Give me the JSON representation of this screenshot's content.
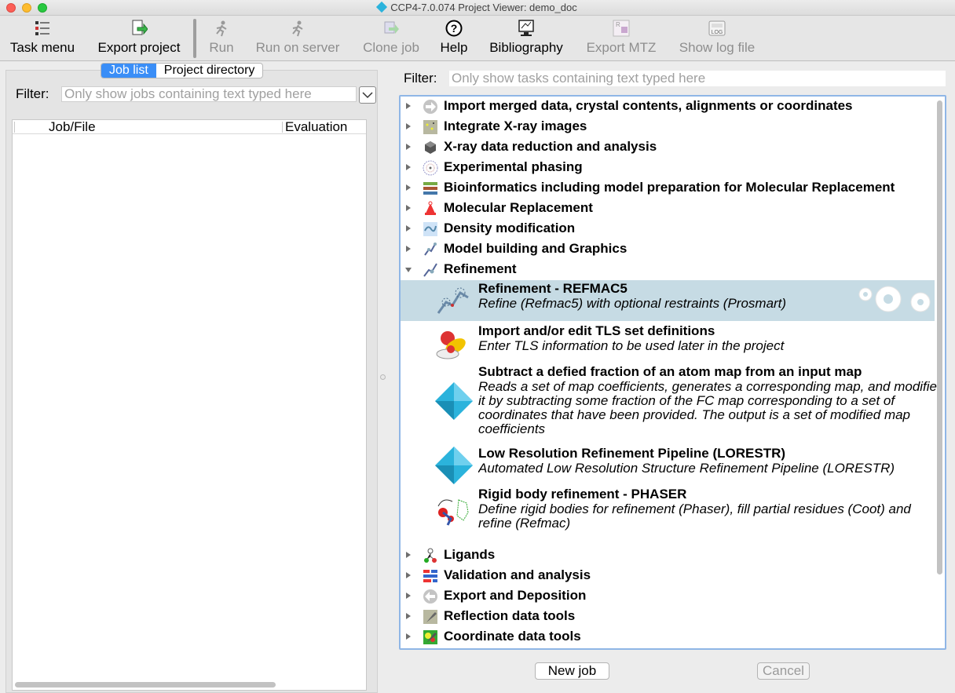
{
  "window": {
    "title": "CCP4-7.0.074 Project Viewer: demo_doc"
  },
  "toolbar": {
    "items": [
      {
        "label": "Task menu",
        "icon": "task-menu-icon",
        "enabled": true
      },
      {
        "label": "Export project",
        "icon": "export-project-icon",
        "enabled": true
      },
      {
        "label": "Run",
        "icon": "run-icon",
        "enabled": false
      },
      {
        "label": "Run on server",
        "icon": "run-server-icon",
        "enabled": false
      },
      {
        "label": "Clone job",
        "icon": "clone-job-icon",
        "enabled": false
      },
      {
        "label": "Help",
        "icon": "help-icon",
        "enabled": true
      },
      {
        "label": "Bibliography",
        "icon": "bibliography-icon",
        "enabled": true
      },
      {
        "label": "Export MTZ",
        "icon": "export-mtz-icon",
        "enabled": false
      },
      {
        "label": "Show log file",
        "icon": "log-file-icon",
        "enabled": false
      }
    ]
  },
  "left": {
    "tabs": [
      {
        "label": "Job list",
        "active": true
      },
      {
        "label": "Project directory",
        "active": false
      }
    ],
    "filter_label": "Filter:",
    "filter_placeholder": "Only show jobs containing text typed here",
    "columns": [
      "Job/File",
      "Evaluation"
    ]
  },
  "right": {
    "filter_label": "Filter:",
    "filter_placeholder": "Only show tasks containing text typed here",
    "categories_before": [
      {
        "label": "Import merged data, crystal contents, alignments or coordinates",
        "icon": "import-arrow-icon"
      },
      {
        "label": "Integrate X-ray images",
        "icon": "diffraction-images-icon"
      },
      {
        "label": "X-ray data reduction and analysis",
        "icon": "data-reduction-icon"
      },
      {
        "label": "Experimental phasing",
        "icon": "experimental-phasing-icon"
      },
      {
        "label": "Bioinformatics including model preparation for Molecular Replacement",
        "icon": "bioinformatics-icon"
      },
      {
        "label": "Molecular Replacement",
        "icon": "molecular-replacement-icon"
      },
      {
        "label": "Density modification",
        "icon": "density-modification-icon"
      },
      {
        "label": "Model building and Graphics",
        "icon": "model-building-icon"
      }
    ],
    "expanded_category": {
      "label": "Refinement",
      "icon": "refinement-icon"
    },
    "tasks": [
      {
        "title": "Refinement - REFMAC5",
        "desc": [
          "Refine (Refmac5) with optional restraints (Prosmart)"
        ],
        "icon": "refmac-icon",
        "selected": true
      },
      {
        "title": "Import and/or edit TLS set definitions",
        "desc": [
          "Enter TLS information to be used later in the project"
        ],
        "icon": "tls-icon",
        "selected": false
      },
      {
        "title": "Subtract a defied fraction of an atom map from an input map",
        "desc": [
          "Reads a set of map coefficients, generates a corresponding map, and modifies",
          "it by subtracting some fraction of the FC map corresponding to a set of",
          "coordinates that have been provided. The output is a set of modified map",
          "coefficients"
        ],
        "icon": "ccp4-diamond-icon",
        "selected": false
      },
      {
        "title": "Low Resolution Refinement Pipeline (LORESTR)",
        "desc": [
          "Automated Low Resolution Structure Refinement Pipeline (LORESTR)"
        ],
        "icon": "ccp4-diamond-icon",
        "selected": false
      },
      {
        "title": "Rigid body refinement - PHASER",
        "desc": [
          "Define rigid bodies for refinement (Phaser), fill partial residues (Coot) and",
          "refine (Refmac)"
        ],
        "icon": "rigid-body-icon",
        "selected": false
      }
    ],
    "categories_after": [
      {
        "label": "Ligands",
        "icon": "ligands-icon"
      },
      {
        "label": "Validation and analysis",
        "icon": "validation-icon"
      },
      {
        "label": "Export and Deposition",
        "icon": "export-deposition-icon"
      },
      {
        "label": "Reflection data tools",
        "icon": "reflection-tools-icon"
      },
      {
        "label": "Coordinate data tools",
        "icon": "coordinate-tools-icon"
      }
    ]
  },
  "buttons": {
    "new_job": "New job",
    "cancel": "Cancel"
  },
  "colors": {
    "selected_row": "#c6dbe4",
    "active_tab": "#3a8ef7",
    "ccp4_diamond": "#2bb3dc"
  }
}
